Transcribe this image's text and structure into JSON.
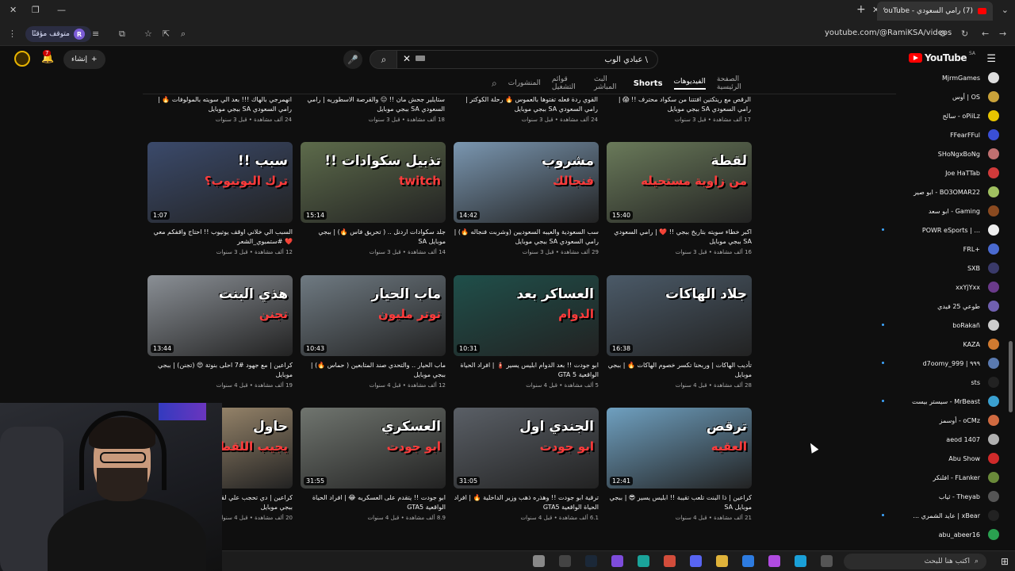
{
  "browser": {
    "tab_title": "(7) رامي السعودي - YouTube",
    "url": "youtube.com/@RamiKSA/videos",
    "paused_label": "متوقف مؤقتًا",
    "profile_initial": "R",
    "new_tab": "+",
    "close": "✕"
  },
  "header": {
    "logo_text": "YouTube",
    "logo_region": "SA",
    "search_query": "عبادي الوب \\",
    "create_label": "إنشاء",
    "notifications_count": "7"
  },
  "channel_tabs": [
    {
      "label": "الصفحة الرئيسية",
      "state": "normal"
    },
    {
      "label": "الفيديوهات",
      "state": "active"
    },
    {
      "label": "Shorts",
      "state": "bold"
    },
    {
      "label": "البث المباشر",
      "state": "normal"
    },
    {
      "label": "قوائم التشغيل",
      "state": "normal"
    },
    {
      "label": "المنشورات",
      "state": "normal"
    }
  ],
  "top_row": [
    {
      "title": "الرقص مع ريتكتين افتتنا من سكواد محترف !! 😱 | رامي السعودي SA ببجي موبايل",
      "meta": "17 ألف مشاهدة • قبل 3 سنوات"
    },
    {
      "title": "القوي ردة فعله تفتوها بالعموس 🔥 رحلة الكوكتر | رامي السعودي SA ببجي موبايل",
      "meta": "24 ألف مشاهدة • قبل 3 سنوات"
    },
    {
      "title": "ستايلير جحش مان !! 😑 والقرصة الاسطوريه | رامي السعودي SA ببجي موبايل",
      "meta": "18 ألف مشاهدة • قبل 3 سنوات"
    },
    {
      "title": "انهمرجي بالهاك !!! بعد الي سويته بالمولوفات 🔥 | رامي السعودي SA ببجي موبايل",
      "meta": "24 ألف مشاهدة • قبل 3 سنوات"
    }
  ],
  "videos": [
    {
      "thumb_main": "لقطة",
      "thumb_sub": "من زاوية مستحيله",
      "duration": "15:40",
      "title": "اكبر خطاء سويته بتاريخ ببجي !! ❤️ | رامي السعودي SA ببجي موبايل",
      "meta": "16 ألف مشاهدة • قبل 3 سنوات",
      "bg": "#6a7a5a"
    },
    {
      "thumb_main": "مشروب",
      "thumb_sub": "فنجالك",
      "duration": "14:42",
      "title": "سب السعودية والعيبه السعوديين (وشربت فنجاله 🔥) | رامي السعودي SA ببجي موبايل",
      "meta": "29 ألف مشاهدة • قبل 3 سنوات",
      "bg": "#7a96b0"
    },
    {
      "thumb_main": "تذبيل سكوادات !!",
      "thumb_sub": "twitch",
      "duration": "15:14",
      "title": "جلد سكوادات اردنل .. ( تحريق فاس 🔥) | ببجي موبايل SA",
      "meta": "14 ألف مشاهدة • قبل 3 سنوات",
      "bg": "#5d6b4b"
    },
    {
      "thumb_main": "سبب !!",
      "thumb_sub": "ترك اليوتيوب؟",
      "duration": "1:07",
      "title": "السبب الي خلاني اوقف يوتيوب !! احتاج واقفكم معي ❤️ #ستمبوي_الشعر",
      "meta": "12 ألف مشاهدة • قبل 3 سنوات",
      "bg": "#3b4a6b"
    },
    {
      "thumb_main": "جلاد الهاكات",
      "thumb_sub": "",
      "duration": "16:38",
      "title": "تأديب الهاكات | وربحنا تكسر خصوم الهاكات 🔥 | ببجي موبايل",
      "meta": "28 ألف مشاهدة • قبل 4 سنوات",
      "bg": "#4b5a68"
    },
    {
      "thumb_main": "العساكر بعد",
      "thumb_sub": "الدوام",
      "duration": "10:31",
      "title": "ابو جودت !! بعد الدوام ابليس يسير 🧯 | افراد الحياة الواقعية GTA 5",
      "meta": "5 ألف مشاهدة • قبل 4 سنوات",
      "bg": "#1f4f4a"
    },
    {
      "thumb_main": "ماب الحيار",
      "thumb_sub": "توتر مليون",
      "duration": "10:43",
      "title": "ماب الحيار .. والتحدي صند المتابعين ( حماس 🔥) | ببجي موبايل",
      "meta": "12 ألف مشاهدة • قبل 4 سنوات",
      "bg": "#6f7a82"
    },
    {
      "thumb_main": "هذي البنت",
      "thumb_sub": "تجنن",
      "duration": "13:44",
      "title": "كراعين | مع جهود #7 احلى بنوتة 😍 (تجنن) | ببجي موبايل",
      "meta": "19 ألف مشاهدة • قبل 4 سنوات",
      "bg": "#8a8f95"
    },
    {
      "thumb_main": "ترقص",
      "thumb_sub": "العقيه",
      "duration": "12:41",
      "title": "كراعين | ذا البنت تلعب تقيبة !! ابليس يسير 😎 | ببجي موبايل SA",
      "meta": "21 ألف مشاهدة • قبل 4 سنوات",
      "bg": "#6fa0c0"
    },
    {
      "thumb_main": "الجندي اول",
      "thumb_sub": "ابو جودت",
      "duration": "31:05",
      "title": "ترقية ابو جودت !! وهذره ذهب وزير الداخلية 🔥 | افراد الحياة الواقعية GTA5",
      "meta": "6.1 ألف مشاهدة • قبل 4 سنوات",
      "bg": "#5a5f66"
    },
    {
      "thumb_main": "العسكري",
      "thumb_sub": "ابو جودت",
      "duration": "31:55",
      "title": "ابو جودت !! يتقدم على العسكريه 😂 | افراد الحياة الواقعية GTA5",
      "meta": "8.9 ألف مشاهدة • قبل 4 سنوات",
      "bg": "#70756f"
    },
    {
      "thumb_main": "حاول",
      "thumb_sub": "يجيب اللقطة",
      "duration": "",
      "title": "كراعين | دي تحجب علي لقطة !! رامي السعودي SA ببجي موبايل",
      "meta": "20 ألف مشاهدة • قبل 4 سنوات",
      "bg": "#b09a7a"
    }
  ],
  "subscriptions": [
    {
      "name": "MjrmGames",
      "color": "#ddd",
      "dot": false
    },
    {
      "name": "أوس | OS",
      "color": "#c9a23a",
      "dot": false
    },
    {
      "name": "سالح - oPiiLz",
      "color": "#e8c400",
      "dot": false
    },
    {
      "name": "FFearFFul",
      "color": "#3a4fd6",
      "dot": false
    },
    {
      "name": "SHoNgxBoNg",
      "color": "#c07070",
      "dot": false
    },
    {
      "name": "Joe HaTTab",
      "color": "#d03a3a",
      "dot": false
    },
    {
      "name": "ابو صير - BO3OMAR22",
      "color": "#a0c060",
      "dot": false
    },
    {
      "name": "ابو سعد - Gaming",
      "color": "#8a4a20",
      "dot": false
    },
    {
      "name": "POWR eSports | ...",
      "color": "#eee",
      "dot": true
    },
    {
      "name": "FRL+",
      "color": "#4a6ad0",
      "dot": false
    },
    {
      "name": "SXB",
      "color": "#3a3a6a",
      "dot": false
    },
    {
      "name": "xxYjYxx",
      "color": "#6a3a8a",
      "dot": false
    },
    {
      "name": "طوعي 25 فيدي",
      "color": "#7060b0",
      "dot": false
    },
    {
      "name": "boRakañ",
      "color": "#ccc",
      "dot": true
    },
    {
      "name": "KAZA",
      "color": "#d07a30",
      "dot": false
    },
    {
      "name": "d7oomy_999 | ٩٩٩",
      "color": "#5a7ab0",
      "dot": true
    },
    {
      "name": "sts",
      "color": "#222",
      "dot": false
    },
    {
      "name": "سيستر بيست - MrBeast",
      "color": "#3aa0d0",
      "dot": true
    },
    {
      "name": "أوسمز - oCMz",
      "color": "#d06a40",
      "dot": false
    },
    {
      "name": "aeod 1407",
      "color": "#b0b0b0",
      "dot": false
    },
    {
      "name": "Abu Show",
      "color": "#d02a2a",
      "dot": false
    },
    {
      "name": "افلنكر - FLanker",
      "color": "#6a8a3a",
      "dot": false
    },
    {
      "name": "ثياب - Theyab",
      "color": "#555",
      "dot": false
    },
    {
      "name": "... عايد الشمري | xBear",
      "color": "#222",
      "dot": true
    },
    {
      "name": "abu_abeer16",
      "color": "#2aa050",
      "dot": false
    }
  ],
  "taskbar": {
    "search_placeholder": "اكتب هنا للبحث",
    "icons": [
      "task-view",
      "next",
      "steam",
      "obs",
      "app",
      "chrome",
      "discord",
      "files",
      "store",
      "copilot",
      "edge",
      "taskmgr"
    ]
  }
}
